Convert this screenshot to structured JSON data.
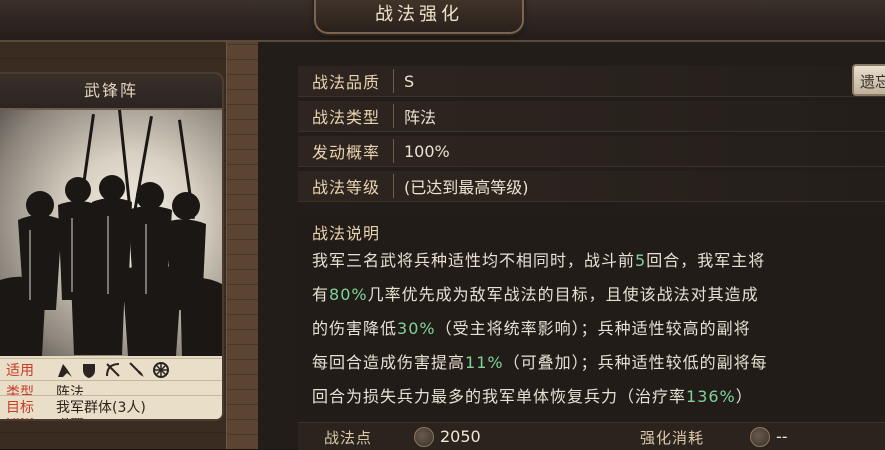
{
  "header": {
    "title": "战法强化"
  },
  "card": {
    "name": "武锋阵",
    "stats": [
      {
        "key": "适用",
        "value": ""
      },
      {
        "key": "类型",
        "value": "阵法"
      },
      {
        "key": "效果",
        "value": "增益"
      },
      {
        "key": "目标",
        "value": "我军群体(3人)"
      }
    ],
    "troop_icons": [
      "cavalry-icon",
      "shield-icon",
      "archer-icon",
      "spear-icon",
      "siege-icon"
    ]
  },
  "details": {
    "quality": {
      "label": "战法品质",
      "value": "S"
    },
    "type": {
      "label": "战法类型",
      "value": "阵法"
    },
    "trigger": {
      "label": "发动概率",
      "value": "100%"
    },
    "level": {
      "label": "战法等级",
      "value": "(已达到最高等级)"
    },
    "side_button": "遗忘"
  },
  "description": {
    "title": "战法说明",
    "lines": [
      [
        {
          "t": "我军三名武将兵种适性均不相同时，战斗前"
        },
        {
          "t": "5",
          "hl": true
        },
        {
          "t": "回合，我军主将"
        }
      ],
      [
        {
          "t": "有"
        },
        {
          "t": "80%",
          "hl": true
        },
        {
          "t": "几率优先成为敌军战法的目标，且使该战法对其造成"
        }
      ],
      [
        {
          "t": "的伤害降低"
        },
        {
          "t": "30%",
          "hl": true
        },
        {
          "t": "（受主将统率影响）；兵种适性较高的副将"
        }
      ],
      [
        {
          "t": "每回合造成伤害提高"
        },
        {
          "t": "11%",
          "hl": true
        },
        {
          "t": "（可叠加）；兵种适性较低的副将每"
        }
      ],
      [
        {
          "t": "回合为损失兵力最多的我军单体恢复兵力（治疗率"
        },
        {
          "t": "136%",
          "hl": true
        },
        {
          "t": "）"
        }
      ]
    ]
  },
  "footer": {
    "points_label": "战法点",
    "points_value": "2050",
    "cost_label": "强化消耗",
    "cost_value": "--"
  },
  "colors": {
    "highlight": "#7fd39a",
    "stat_key": "#c83c2a"
  }
}
